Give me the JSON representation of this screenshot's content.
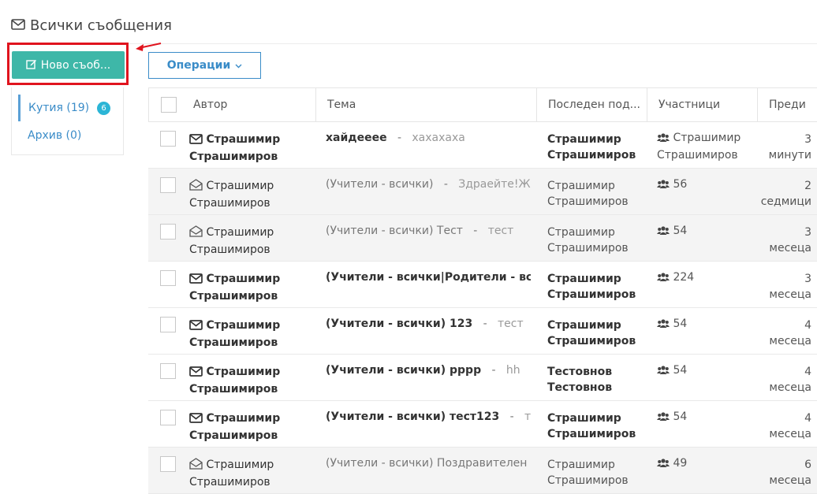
{
  "header": {
    "title": "Всички съобщения"
  },
  "sidebar": {
    "new_label": "Ново съоб...",
    "items": [
      {
        "label": "Кутия (19)",
        "badge": "6"
      },
      {
        "label": "Архив (0)"
      }
    ]
  },
  "toolbar": {
    "operations_label": "Операции"
  },
  "table": {
    "columns": [
      "Автор",
      "Тема",
      "Последен под...",
      "Участници",
      "Преди"
    ],
    "rows": [
      {
        "unread": true,
        "author1": "Страшимир",
        "author2": "Страшимиров",
        "topic": "хайдееее",
        "sep": "-",
        "snippet": "хахахаха",
        "last1": "Страшимир",
        "last2": "Страшимиров",
        "part1": "Страшимир",
        "part2": "Страшимиров",
        "when1": "3",
        "when2": "минути"
      },
      {
        "unread": false,
        "author1": "Страшимир",
        "author2": "Страшимиров",
        "topic": "(Учители - всички)",
        "sep": "-",
        "snippet": "Здраейте!Же...",
        "last1": "Страшимир",
        "last2": "Страшимиров",
        "part1": "56",
        "part2": "",
        "when1": "2",
        "when2": "седмици"
      },
      {
        "unread": false,
        "author1": "Страшимир",
        "author2": "Страшимиров",
        "topic": "(Учители - всички) Тест",
        "sep": "-",
        "snippet": "тест",
        "last1": "Страшимир",
        "last2": "Страшимиров",
        "part1": "54",
        "part2": "",
        "when1": "3",
        "when2": "месеца"
      },
      {
        "unread": true,
        "author1": "Страшимир",
        "author2": "Страшимиров",
        "topic": "(Учители - всички|Родители - вс...",
        "sep": "",
        "snippet": "",
        "last1": "Страшимир",
        "last2": "Страшимиров",
        "part1": "224",
        "part2": "",
        "when1": "3",
        "when2": "месеца"
      },
      {
        "unread": true,
        "author1": "Страшимир",
        "author2": "Страшимиров",
        "topic": "(Учители - всички) 123",
        "sep": "-",
        "snippet": "тест",
        "last1": "Страшимир",
        "last2": "Страшимиров",
        "part1": "54",
        "part2": "",
        "when1": "4",
        "when2": "месеца"
      },
      {
        "unread": true,
        "author1": "Страшимир",
        "author2": "Страшимиров",
        "topic": "(Учители - всички) рррр",
        "sep": "-",
        "snippet": "hh",
        "last1": "Тестовнов",
        "last2": "Тестовнов",
        "part1": "54",
        "part2": "",
        "when1": "4",
        "when2": "месеца"
      },
      {
        "unread": true,
        "author1": "Страшимир",
        "author2": "Страшимиров",
        "topic": "(Учители - всички) тест123",
        "sep": "-",
        "snippet": "тес...",
        "last1": "Страшимир",
        "last2": "Страшимиров",
        "part1": "54",
        "part2": "",
        "when1": "4",
        "when2": "месеца"
      },
      {
        "unread": false,
        "author1": "Страшимир",
        "author2": "Страшимиров",
        "topic": "(Учители - всички) Поздравителен ...",
        "sep": "",
        "snippet": "",
        "last1": "Страшимир",
        "last2": "Страшимиров",
        "part1": "49",
        "part2": "",
        "when1": "6",
        "when2": "месеца"
      }
    ]
  },
  "colors": {
    "accent": "#3eb7a8",
    "link": "#3a8cc8",
    "highlight": "#e0141e",
    "badge": "#2bb5d6"
  },
  "icons": {
    "title": "envelope-icon",
    "new": "edit-icon",
    "unread": "envelope-icon",
    "read": "envelope-open-icon",
    "participants": "users-icon",
    "ops": "chevron-down-icon"
  }
}
